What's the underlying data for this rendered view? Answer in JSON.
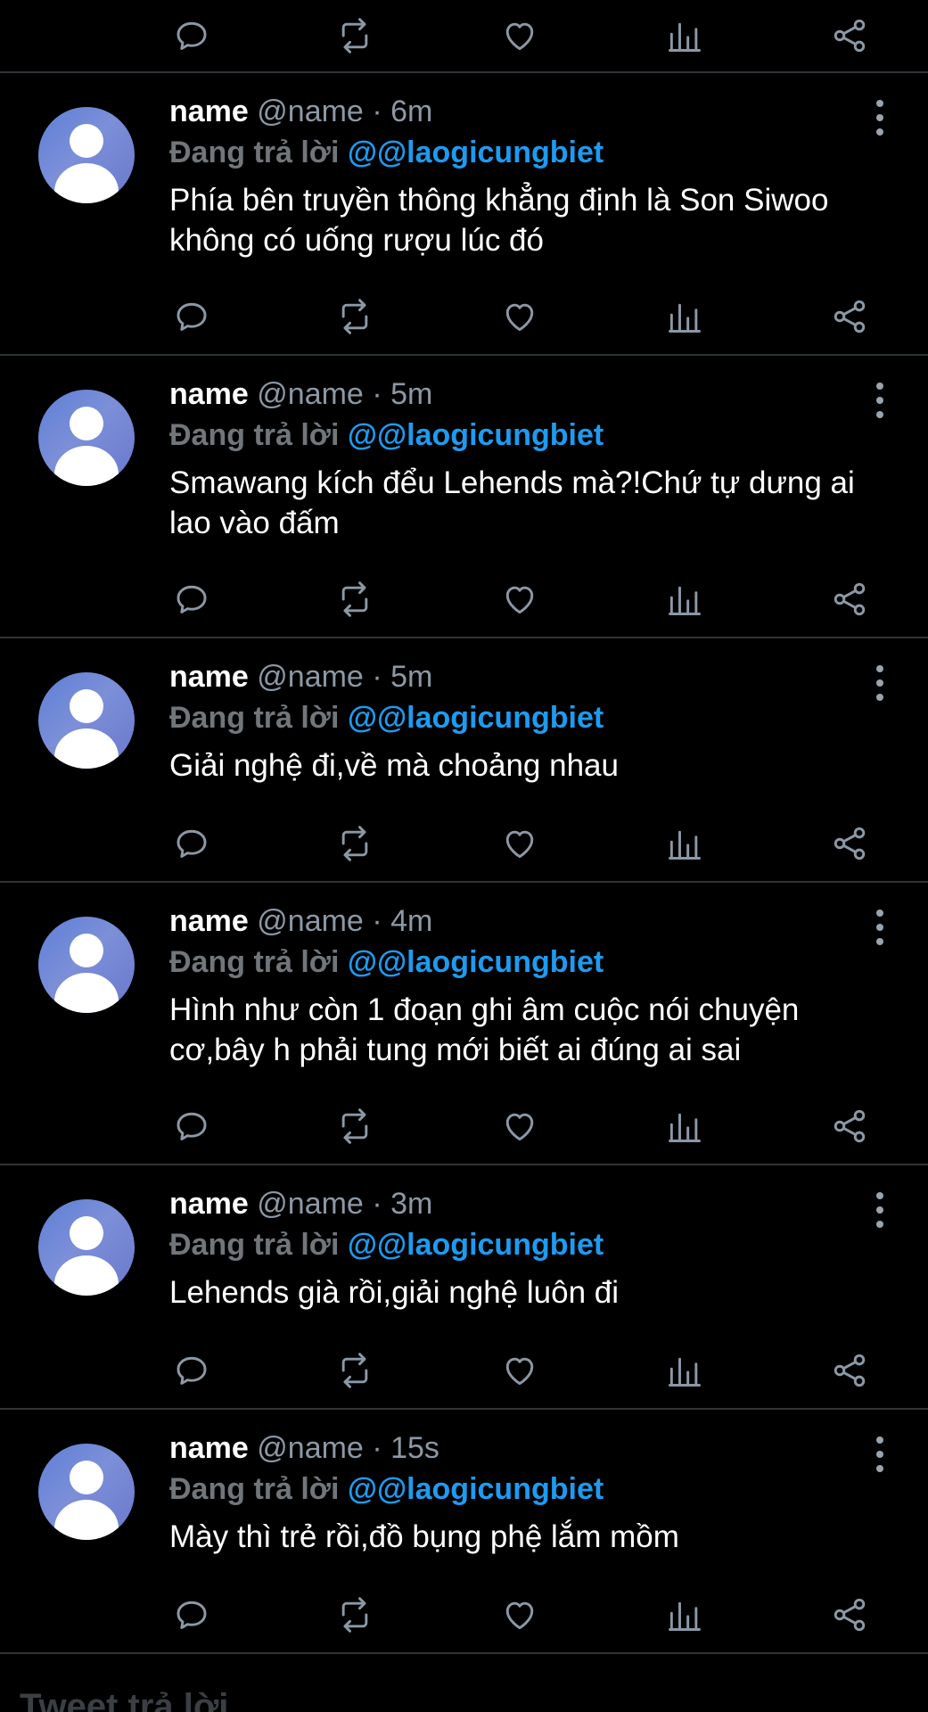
{
  "icons": {
    "reply": "reply-icon",
    "retweet": "retweet-icon",
    "like": "like-icon",
    "views": "views-icon",
    "share": "share-icon",
    "more": "more-vertical-icon",
    "avatar": "default-avatar"
  },
  "colors": {
    "background": "#000000",
    "divider": "#2f3336",
    "link": "#1d9bf0",
    "muted": "#71767b",
    "icon": "#8b98a5"
  },
  "tweets": [
    {
      "name": "name",
      "handle": "@name",
      "separator": "·",
      "time": "6m",
      "reply_prefix": "Đang trả lời",
      "reply_to": "@@laogicungbiet",
      "text": "Phía bên truyền thông khẳng định là Son Siwoo không có uống rượu lúc đó"
    },
    {
      "name": "name",
      "handle": "@name",
      "separator": "·",
      "time": "5m",
      "reply_prefix": "Đang trả lời",
      "reply_to": "@@laogicungbiet",
      "text": "Smawang kích đểu Lehends mà?!Chứ tự dưng ai lao vào đấm"
    },
    {
      "name": "name",
      "handle": "@name",
      "separator": "·",
      "time": "5m",
      "reply_prefix": "Đang trả lời",
      "reply_to": "@@laogicungbiet",
      "text": "Giải nghệ đi,về mà choảng nhau"
    },
    {
      "name": "name",
      "handle": "@name",
      "separator": "·",
      "time": "4m",
      "reply_prefix": "Đang trả lời",
      "reply_to": "@@laogicungbiet",
      "text": "Hình như còn 1 đoạn ghi âm cuộc nói chuyện cơ,bây h phải tung mới biết ai đúng ai sai"
    },
    {
      "name": "name",
      "handle": "@name",
      "separator": "·",
      "time": "3m",
      "reply_prefix": "Đang trả lời",
      "reply_to": "@@laogicungbiet",
      "text": "Lehends già rồi,giải nghệ luôn đi"
    },
    {
      "name": "name",
      "handle": "@name",
      "separator": "·",
      "time": "15s",
      "reply_prefix": "Đang trả lời",
      "reply_to": "@@laogicungbiet",
      "text": "Mày thì trẻ rồi,đồ bụng phệ lắm mồm"
    }
  ],
  "footer": {
    "reply_label": "Tweet trả lời"
  }
}
